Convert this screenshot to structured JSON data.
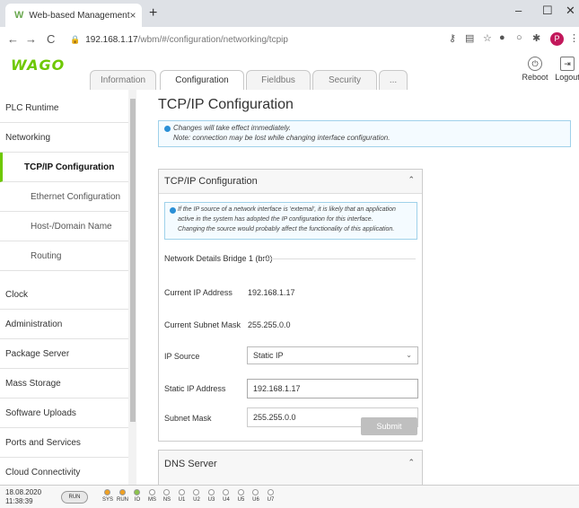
{
  "browser": {
    "tab_title": "Web-based Management",
    "tab_close": "×",
    "new_tab": "+",
    "win_min": "–",
    "win_max": "☐",
    "win_close": "✕",
    "back": "←",
    "forward": "→",
    "reload": "C",
    "url_host": "192.168.1.17",
    "url_path": "/wbm/#/configuration/networking/tcpip",
    "profile_initial": "P"
  },
  "header": {
    "logo": "WAGO",
    "tabs": [
      "Information",
      "Configuration",
      "Fieldbus",
      "Security",
      "..."
    ],
    "active_tab": "Configuration",
    "reboot_label": "Reboot",
    "logout_label": "Logout"
  },
  "sidebar": {
    "items": [
      {
        "label": "PLC Runtime",
        "level": 0
      },
      {
        "label": "Networking",
        "level": 0
      },
      {
        "label": "TCP/IP Configuration",
        "level": 1,
        "current": true
      },
      {
        "label": "Ethernet Configuration",
        "level": 1
      },
      {
        "label": "Host-/Domain Name",
        "level": 1
      },
      {
        "label": "Routing",
        "level": 1
      },
      {
        "label": "Clock",
        "level": 0
      },
      {
        "label": "Administration",
        "level": 0
      },
      {
        "label": "Package Server",
        "level": 0
      },
      {
        "label": "Mass Storage",
        "level": 0
      },
      {
        "label": "Software Uploads",
        "level": 0
      },
      {
        "label": "Ports and Services",
        "level": 0
      },
      {
        "label": "Cloud Connectivity",
        "level": 0
      }
    ]
  },
  "main": {
    "title": "TCP/IP Configuration",
    "notice_line1": "Changes will take effect immediately.",
    "notice_line2": "Note: connection may be lost while changing interface configuration.",
    "panel": {
      "title": "TCP/IP Configuration",
      "info_line1": "If the IP source of a network interface is 'external', it is likely that an application",
      "info_line2": "active in the system has adopted the IP configuration for this interface.",
      "info_line3": "Changing the source would probably affect the functionality of this application.",
      "section_label": "Network Details Bridge 1 (br0)",
      "current_ip_label": "Current IP Address",
      "current_ip": "192.168.1.17",
      "current_mask_label": "Current Subnet Mask",
      "current_mask": "255.255.0.0",
      "ip_source_label": "IP Source",
      "ip_source": "Static IP",
      "static_ip_label": "Static IP Address",
      "static_ip": "192.168.1.17",
      "subnet_mask_label": "Subnet Mask",
      "subnet_mask": "255.255.0.0",
      "submit_label": "Submit"
    },
    "dns_panel_title": "DNS Server"
  },
  "footer": {
    "date": "18.08.2020",
    "time": "11:38:39",
    "run_switch": "RUN",
    "leds": [
      {
        "label": "SYS",
        "color": "#f0a020"
      },
      {
        "label": "RUN",
        "color": "#f0a020"
      },
      {
        "label": "IO",
        "color": "#8bc34a"
      },
      {
        "label": "MS",
        "color": "#ffffff"
      },
      {
        "label": "NS",
        "color": "#ffffff"
      },
      {
        "label": "U1",
        "color": "#ffffff"
      },
      {
        "label": "U2",
        "color": "#ffffff"
      },
      {
        "label": "U3",
        "color": "#ffffff"
      },
      {
        "label": "U4",
        "color": "#ffffff"
      },
      {
        "label": "U5",
        "color": "#ffffff"
      },
      {
        "label": "U6",
        "color": "#ffffff"
      },
      {
        "label": "U7",
        "color": "#ffffff"
      }
    ]
  }
}
